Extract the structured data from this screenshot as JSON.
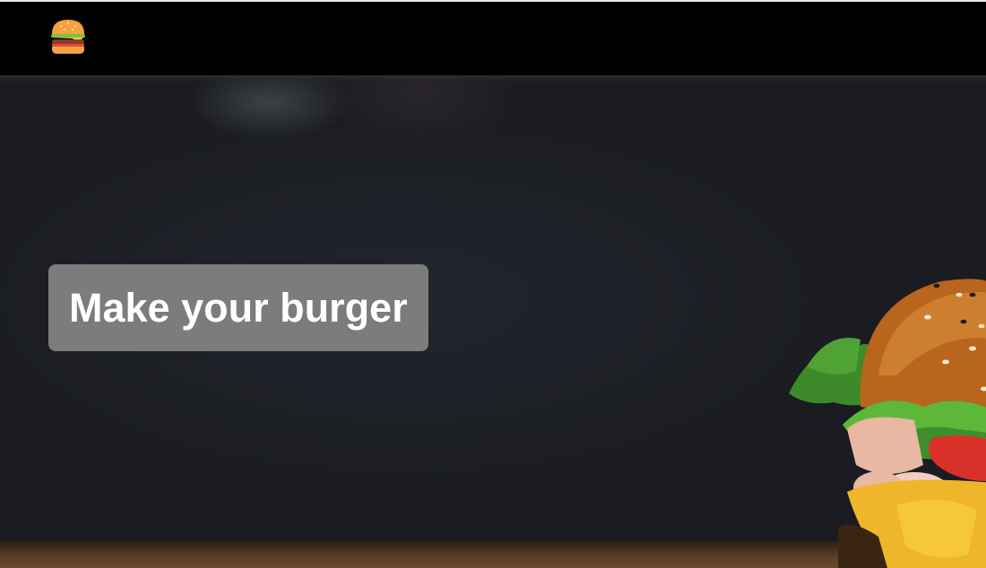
{
  "header": {
    "logo_icon": "burger-icon"
  },
  "hero": {
    "title": "Make your burger",
    "image": "burger-photo"
  },
  "colors": {
    "topbar": "#000000",
    "title_box": "#7c7c7c",
    "title_text": "#ffffff",
    "background": "#1d2026"
  }
}
